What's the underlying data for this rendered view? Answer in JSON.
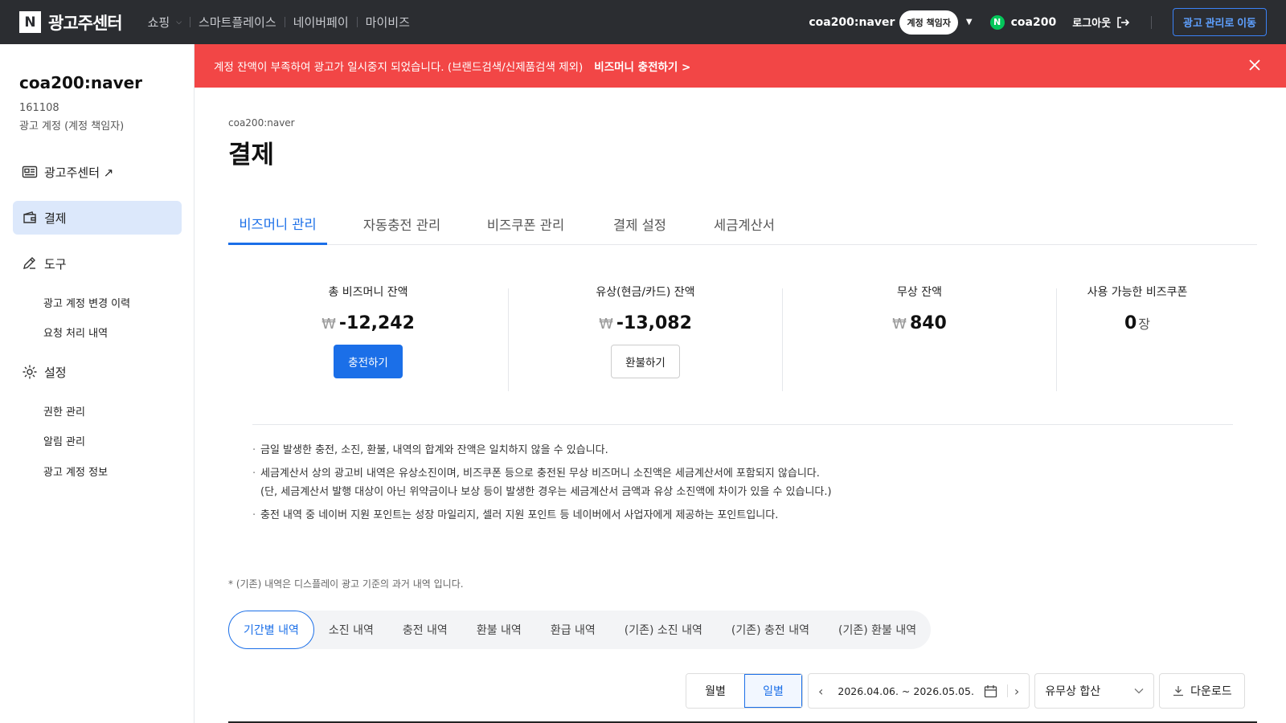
{
  "topbar": {
    "logo_letter": "N",
    "logo_text": "광고주센터",
    "nav": [
      "쇼핑",
      "스마트플레이스",
      "네이버페이",
      "마이비즈"
    ],
    "account_name": "coa200:naver",
    "account_badge": "계정 책임자",
    "user_initial": "N",
    "user_name": "coa200",
    "logout_label": "로그아웃",
    "goto_button": "광고 관리로 이동"
  },
  "sidebar": {
    "account_name": "coa200:naver",
    "account_id": "161108",
    "account_role": "광고 계정 (계정 책임자)",
    "items": {
      "ad_center": "광고주센터 ↗",
      "payment": "결제",
      "tools": "도구",
      "settings": "설정"
    },
    "tools_sub": [
      "광고 계정 변경 이력",
      "요청 처리 내역"
    ],
    "settings_sub": [
      "권한 관리",
      "알림 관리",
      "광고 계정 정보"
    ]
  },
  "alert": {
    "message": "계정 잔액이 부족하여 광고가 일시중지 되었습니다. (브랜드검색/신제품검색 제외)",
    "link": "비즈머니 충전하기 >"
  },
  "page": {
    "breadcrumb": "coa200:naver",
    "title": "결제"
  },
  "tabs": [
    "비즈머니 관리",
    "자동충전 관리",
    "비즈쿠폰 관리",
    "결제 설정",
    "세금계산서"
  ],
  "summary": {
    "currency_symbol": "₩",
    "total": {
      "label": "총 비즈머니 잔액",
      "value": "-12,242",
      "button": "충전하기"
    },
    "paid": {
      "label": "유상(현금/카드) 잔액",
      "value": "-13,082",
      "button": "환불하기"
    },
    "free": {
      "label": "무상 잔액",
      "value": "840"
    },
    "coupon": {
      "label": "사용 가능한 비즈쿠폰",
      "value": "0",
      "unit": "장"
    }
  },
  "notes": [
    "금일 발생한 충전, 소진, 환불, 내역의 합계와 잔액은 일치하지 않을 수 있습니다.",
    "세금계산서 상의 광고비 내역은 유상소진이며, 비즈쿠폰 등으로 충전된 무상 비즈머니 소진액은 세금계산서에 포함되지 않습니다.",
    "(단, 세금계산서 발행 대상이 아닌 위약금이나 보상 등이 발생한 경우는 세금계산서 금액과 유상 소진액에 차이가 있을 수 있습니다.)",
    "충전 내역 중 네이버 지원 포인트는 성장 마일리지, 셀러 지원 포인트 등 네이버에서 사업자에게 제공하는 포인트입니다."
  ],
  "legacy_note": "* (기존) 내역은 디스플레이 광고 기준의 과거 내역 입니다.",
  "subtabs": [
    "기간별 내역",
    "소진 내역",
    "충전 내역",
    "환불 내역",
    "환급 내역",
    "(기존) 소진 내역",
    "(기존) 충전 내역",
    "(기존) 환불 내역"
  ],
  "toolbar": {
    "monthly": "월별",
    "daily": "일별",
    "date_range": "2026.04.06. ~ 2026.05.05.",
    "filter": "유무상 합산",
    "download": "다운로드"
  }
}
